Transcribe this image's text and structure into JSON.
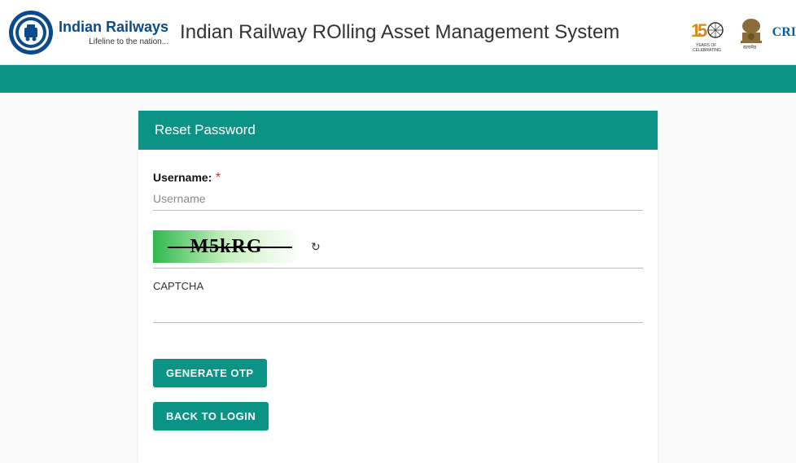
{
  "header": {
    "brand_main": "Indian Railways",
    "brand_sub": "Lifeline to the nation...",
    "system_title": "Indian Railway ROlling Asset Management System",
    "cris_text": "CRI"
  },
  "card": {
    "title": "Reset Password",
    "username_label": "Username:",
    "username_placeholder": "Username",
    "captcha_value": "M5kRG",
    "captcha_label": "CAPTCHA",
    "generate_otp": "GENERATE OTP",
    "back_to_login": "BACK TO LOGIN"
  },
  "colors": {
    "teal": "#0b9485",
    "blue": "#0a4b8c"
  }
}
